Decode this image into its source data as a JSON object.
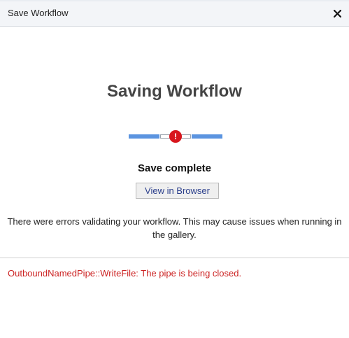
{
  "dialog": {
    "title": "Save Workflow",
    "close_icon": "close-icon"
  },
  "main": {
    "heading": "Saving Workflow",
    "progress": {
      "state": "error",
      "error_icon": "error-icon",
      "error_glyph": "!",
      "colors": {
        "segment": "#5b94e0",
        "error": "#d8161d"
      }
    },
    "status": "Save complete",
    "view_button_label": "View in Browser",
    "message": "There were errors validating your workflow. This may cause issues when running in the gallery.",
    "error_detail": "OutboundNamedPipe::WriteFile: The pipe is being closed."
  }
}
